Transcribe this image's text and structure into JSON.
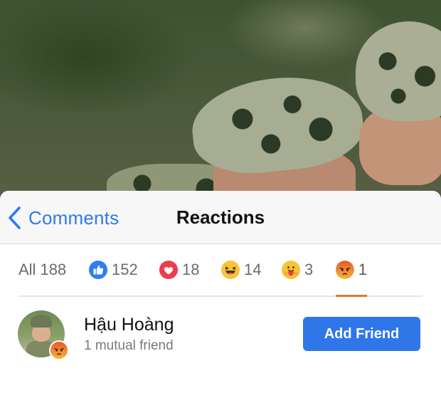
{
  "nav": {
    "back_label": "Comments",
    "title": "Reactions"
  },
  "tabs": [
    {
      "id": "all",
      "label": "All",
      "count": "188",
      "icon": null,
      "active": false
    },
    {
      "id": "like",
      "label": "",
      "count": "152",
      "icon": "like-icon",
      "active": false
    },
    {
      "id": "love",
      "label": "",
      "count": "18",
      "icon": "love-icon",
      "active": false
    },
    {
      "id": "haha",
      "label": "",
      "count": "14",
      "icon": "haha-icon",
      "active": false
    },
    {
      "id": "care",
      "label": "",
      "count": "3",
      "icon": "care-icon",
      "active": false
    },
    {
      "id": "angry",
      "label": "",
      "count": "1",
      "icon": "angry-icon",
      "active": true
    }
  ],
  "people": [
    {
      "name": "Hậu Hoàng",
      "subtitle": "1 mutual friend",
      "reaction_icon": "angry-icon",
      "button_label": "Add Friend"
    }
  ],
  "colors": {
    "accent_blue": "#2f77e8",
    "link_blue": "#2d79f0",
    "active_tab_underline": "#e07a2c"
  }
}
